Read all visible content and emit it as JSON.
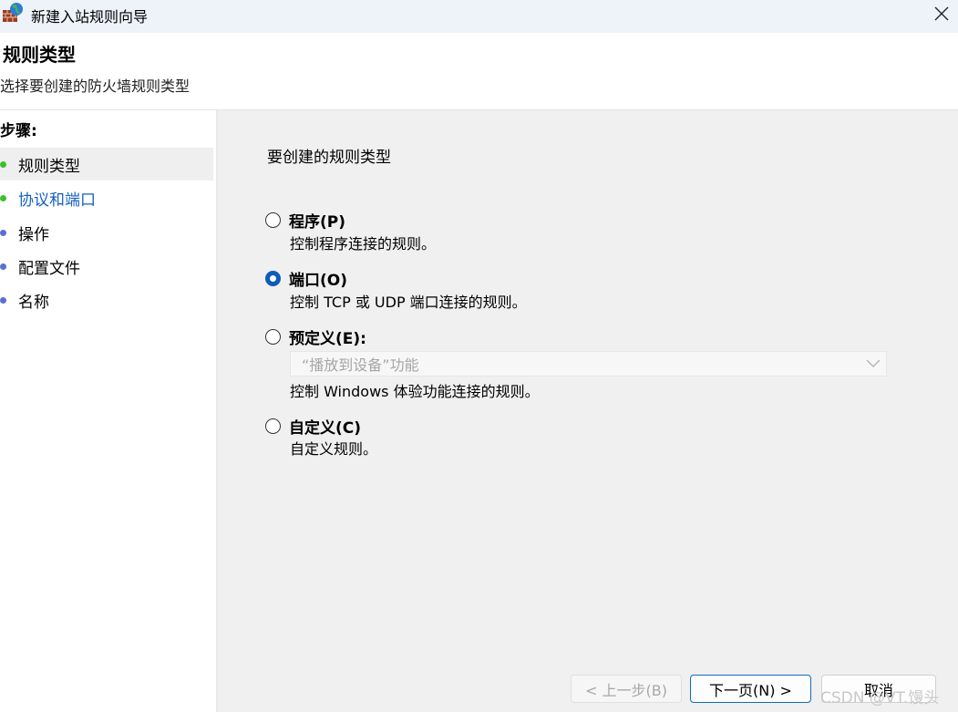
{
  "window": {
    "title": "新建入站规则向导",
    "icon": "firewall-globe-icon"
  },
  "header": {
    "title": "规则类型",
    "subtitle": "选择要创建的防火墙规则类型"
  },
  "steps": {
    "heading": "步骤:",
    "items": [
      {
        "label": "规则类型",
        "state": "done",
        "current": true
      },
      {
        "label": "协议和端口",
        "state": "done",
        "current": false
      },
      {
        "label": "操作",
        "state": "todo",
        "current": false
      },
      {
        "label": "配置文件",
        "state": "todo",
        "current": false
      },
      {
        "label": "名称",
        "state": "todo",
        "current": false
      }
    ]
  },
  "content": {
    "intro": "要创建的规则类型",
    "options": [
      {
        "label": "程序(P)",
        "desc": "控制程序连接的规则。",
        "checked": false
      },
      {
        "label": "端口(O)",
        "desc": "控制 TCP 或 UDP 端口连接的规则。",
        "checked": true
      },
      {
        "label": "预定义(E):",
        "desc": "控制 Windows 体验功能连接的规则。",
        "checked": false
      },
      {
        "label": "自定义(C)",
        "desc": "自定义规则。",
        "checked": false
      }
    ],
    "predefined_select": {
      "value": "“播放到设备”功能",
      "enabled": false
    }
  },
  "buttons": {
    "back": "< 上一步(B)",
    "next": "下一页(N) >",
    "cancel": "取消"
  },
  "watermark": "CSDN @VT.馒头",
  "colors": {
    "accent": "#0f5bb8",
    "step_done": "#3fbf2e",
    "step_todo": "#5c6fd1",
    "link": "#1560c0",
    "content_bg": "#f0f0f0"
  }
}
